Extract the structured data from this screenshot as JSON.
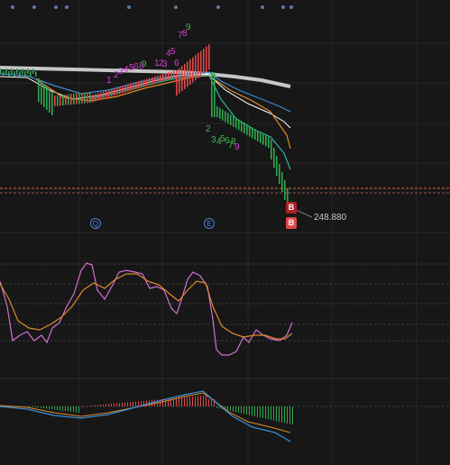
{
  "colors": {
    "background": "#171717",
    "grid": "#262626",
    "up_candle": "#e04848",
    "down_candle": "#2fa84f",
    "ma_white": "#ffffff",
    "ma_gray_thick": "#bdbdbd",
    "ma_orange": "#e08a2a",
    "ma_blue": "#3a8fd8",
    "ma_teal": "#2bb5a0",
    "kdj_pink": "#d070d0",
    "kdj_orange": "#e08a2a",
    "macd_blue": "#3a8fd8",
    "price_line": "#e0613a",
    "td_green": "#3fb34f",
    "td_magenta": "#d040d0",
    "td_red": "#e04848"
  },
  "price": {
    "last_label": "248.880"
  },
  "markers": {
    "buy_label_1": "B",
    "buy_label_2": "B"
  },
  "events": {
    "event_1": "Q",
    "event_2": "E"
  },
  "td_sequence": {
    "up_digits_a": [
      "1",
      "2",
      "3",
      "4",
      "5",
      "6",
      "7",
      "8",
      "9"
    ],
    "up_digits_b": [
      "1",
      "2",
      "3"
    ],
    "up_digits_c": [
      "4",
      "5",
      "6"
    ],
    "up_digits_d": [
      "7",
      "8",
      "9"
    ],
    "down_digits": [
      "2",
      "3",
      "4",
      "5",
      "6",
      "7",
      "8",
      "9"
    ]
  },
  "top_dots": {
    "icon": "event-dot-icon"
  }
}
